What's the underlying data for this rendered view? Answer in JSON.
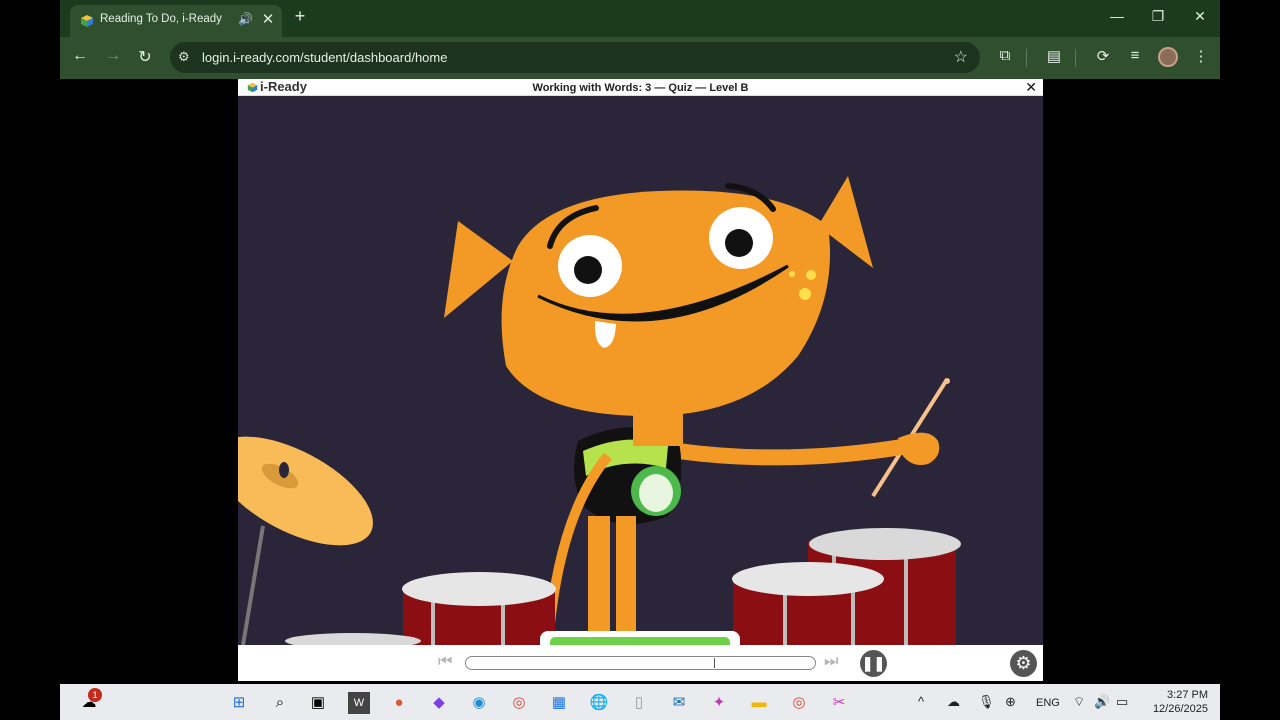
{
  "browser": {
    "tab": {
      "title": "Reading To Do, i-Ready",
      "audio_icon": "speaker-icon",
      "close": "✕"
    },
    "new_tab": "+",
    "window_controls": {
      "minimize": "—",
      "restore": "❐",
      "close": "✕"
    },
    "url": "login.i-ready.com/student/dashboard/home"
  },
  "app": {
    "logo": "i-Ready",
    "lesson_title": "Working with Words: 3 — Quiz — Level B",
    "close": "✕"
  },
  "player": {
    "progress_fraction": 0.71,
    "pause_icon": "pause-icon",
    "settings_icon": "gear-icon"
  },
  "taskbar": {
    "notification_badge": "1",
    "language": "ENG",
    "time": "3:27 PM",
    "date": "12/26/2025"
  },
  "colors": {
    "tab_bar": "#1c3a1e",
    "toolbar": "#2f4f2f",
    "stage_background": "#2a2538",
    "character_orange": "#f39a26",
    "drum_red": "#8b0f12",
    "cymbal_yellow": "#f8bb58"
  }
}
